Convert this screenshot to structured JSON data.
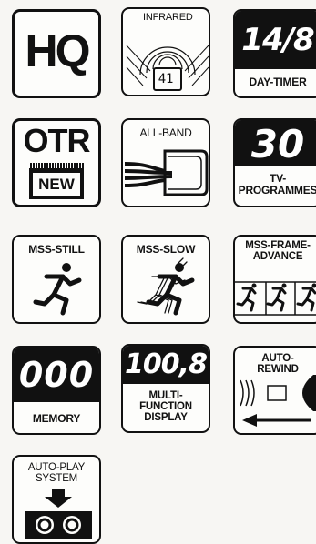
{
  "hq": {
    "text": "HQ"
  },
  "infrared": {
    "label": "INFRARED",
    "channel": "41"
  },
  "day_timer": {
    "display": "14/8",
    "label": "DAY-TIMER"
  },
  "otr": {
    "title": "OTR",
    "badge": "NEW"
  },
  "all_band": {
    "label": "ALL-BAND"
  },
  "tv_programmes": {
    "display": "30",
    "label": "TV-\nPROGRAMMES"
  },
  "mss_still": {
    "label": "MSS-STILL"
  },
  "mss_slow": {
    "label": "MSS-SLOW"
  },
  "mss_frame": {
    "label": "MSS-FRAME-\nADVANCE"
  },
  "memory": {
    "display": "000",
    "label": "MEMORY"
  },
  "multi_function": {
    "display": "100,8",
    "label": "MULTI-\nFUNCTION\nDISPLAY"
  },
  "auto_rewind": {
    "label": "AUTO-\nREWIND"
  },
  "auto_play": {
    "label": "AUTO-PLAY\nSYSTEM"
  }
}
